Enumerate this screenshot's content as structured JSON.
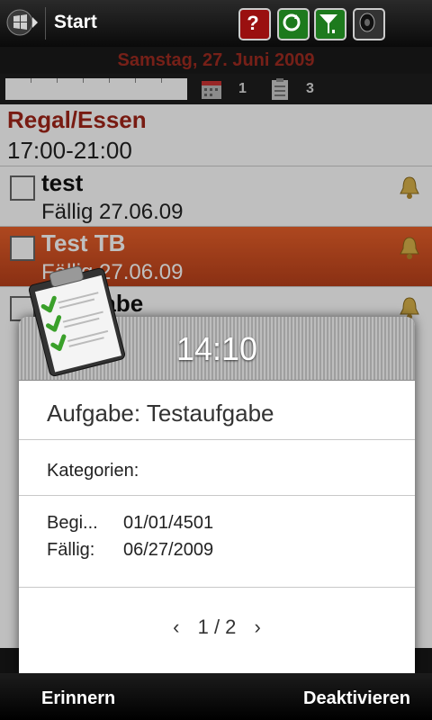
{
  "titlebar": {
    "title": "Start",
    "icons": [
      "windows-start-icon",
      "help-icon",
      "sync-icon",
      "signal-icon",
      "speaker-icon"
    ]
  },
  "app": {
    "date": "Samstag, 27. Juni 2009",
    "toolbar": {
      "calendar_count": "1",
      "tasks_count": "3"
    },
    "appointment": {
      "title": "Regal/Essen",
      "time": "17:00-21:00"
    },
    "tasks": [
      {
        "name": "test",
        "due": "Fällig 27.06.09",
        "highlighted": false
      },
      {
        "name": "Test TB",
        "due": "Fällig 27.06.09",
        "highlighted": true
      },
      {
        "name": "ufgabe",
        "due": "",
        "highlighted": false
      }
    ]
  },
  "reminder": {
    "time": "14:10",
    "title": "Aufgabe: Testaufgabe",
    "category_label": "Kategorien:",
    "begin_label": "Begi...",
    "begin_value": "01/01/4501",
    "due_label": "Fällig:",
    "due_value": "06/27/2009",
    "pager": "1 / 2",
    "prev": "‹",
    "next": "›"
  },
  "softkeys": {
    "left": "Erinnern",
    "right": "Deaktivieren"
  },
  "colors": {
    "date_red": "#9e2b20",
    "highlight": "#e0582a",
    "title_red": "#a02418"
  }
}
